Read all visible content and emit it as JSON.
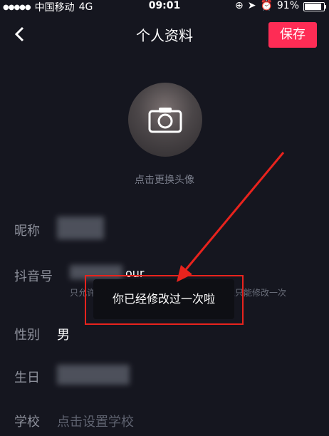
{
  "status_bar": {
    "carrier": "中国移动",
    "network": "4G",
    "time": "09:01",
    "battery": "91%",
    "battery_level": 0.91
  },
  "header": {
    "title": "个人资料",
    "save_label": "保存"
  },
  "avatar": {
    "change_label": "点击更换头像"
  },
  "fields": {
    "nickname_label": "昵称",
    "douyin_id_label": "抖音号",
    "douyin_id_partial": "our",
    "douyin_id_help_left": "只允许包含字母",
    "douyin_id_help_right": "且只能修改一次",
    "gender_label": "性别",
    "gender_value": "男",
    "birthday_label": "生日",
    "school_label": "学校",
    "school_placeholder": "点击设置学校"
  },
  "toast": {
    "message": "你已经修改过一次啦"
  },
  "colors": {
    "background": "#15161f",
    "accent": "#fe2c55",
    "annotation": "#e8231d"
  }
}
